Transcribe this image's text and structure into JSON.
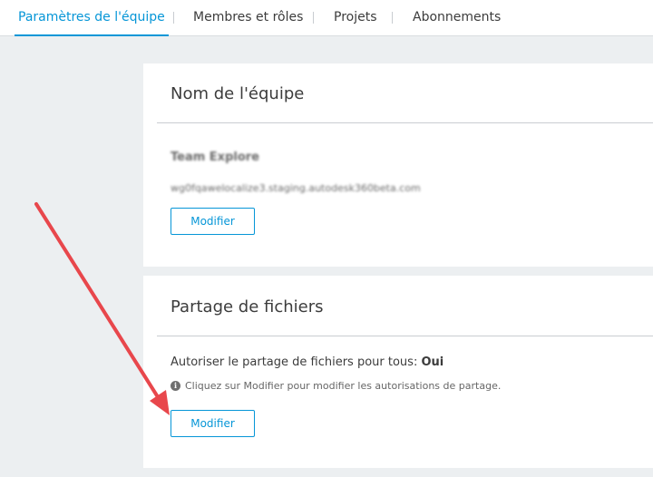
{
  "tabs": [
    {
      "label": "Paramètres de l'équipe",
      "active": true
    },
    {
      "label": "Membres et rôles",
      "active": false
    },
    {
      "label": "Projets",
      "active": false
    },
    {
      "label": "Abonnements",
      "active": false
    }
  ],
  "team_card": {
    "title": "Nom de l'équipe",
    "team_name": "Team Explore",
    "team_url": "wg0fqawelocalize3.staging.autodesk360beta.com",
    "edit_label": "Modifier"
  },
  "sharing_card": {
    "title": "Partage de fichiers",
    "setting_label": "Autoriser le partage de fichiers pour tous:",
    "setting_value": "Oui",
    "hint": "Cliquez sur Modifier pour modifier les autorisations de partage.",
    "edit_label": "Modifier"
  },
  "colors": {
    "accent": "#0696d7",
    "annotation_arrow": "#e8474c",
    "page_background": "#eceff1"
  },
  "icons": {
    "hint_icon": "info-icon"
  }
}
